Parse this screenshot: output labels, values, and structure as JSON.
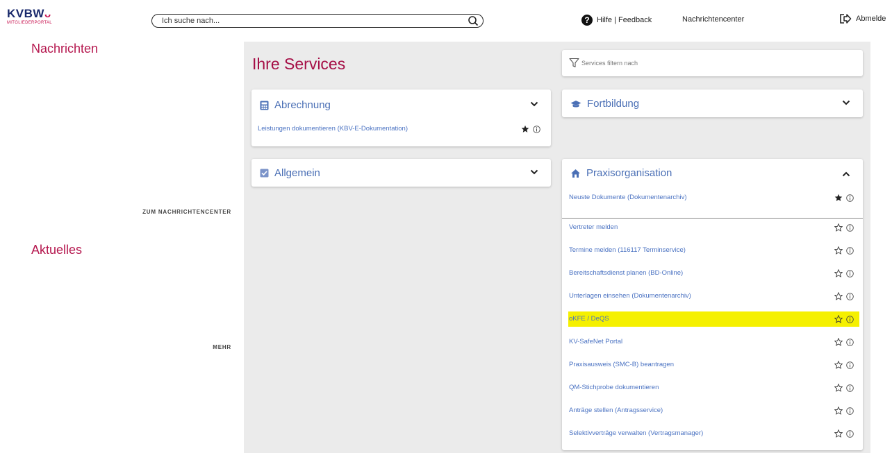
{
  "header": {
    "logo_text": "KVBW",
    "logo_sub": "MITGLIEDERPORTAL",
    "search_placeholder": "Ich suche nach...",
    "help_label": "Hilfe | Feedback",
    "nachrichtencenter_label": "Nachrichtencenter",
    "logout_label": "Abmelde"
  },
  "left": {
    "news_title": "Nachrichten",
    "news_link": "ZUM NACHRICHTENCENTER",
    "current_title": "Aktuelles",
    "current_link": "MEHR"
  },
  "main": {
    "title": "Ihre Services",
    "filter_placeholder": "Services filtern nach",
    "cards": {
      "abrechnung": {
        "title": "Abrechnung",
        "icon": "calculator-icon",
        "items": [
          {
            "label": "Leistungen dokumentieren (KBV-E-Dokumentation)",
            "favorite": true
          }
        ]
      },
      "allgemein": {
        "title": "Allgemein",
        "icon": "checkbox-icon"
      },
      "fortbildung": {
        "title": "Fortbildung",
        "icon": "graduation-cap-icon"
      },
      "praxisorganisation": {
        "title": "Praxisorganisation",
        "icon": "house-icon",
        "favorites": [
          {
            "label": "Neuste Dokumente (Dokumentenarchiv)",
            "favorite": true
          }
        ],
        "items": [
          {
            "label": "Vertreter melden",
            "favorite": false
          },
          {
            "label": "Termine melden (116117 Terminservice)",
            "favorite": false
          },
          {
            "label": "Bereitschaftsdienst planen (BD-Online)",
            "favorite": false
          },
          {
            "label": "Unterlagen einsehen (Dokumentenarchiv)",
            "favorite": false
          },
          {
            "label": "oKFE / DeQS",
            "favorite": false,
            "highlighted": true
          },
          {
            "label": "KV-SafeNet Portal",
            "favorite": false
          },
          {
            "label": "Praxisausweis (SMC-B) beantragen",
            "favorite": false
          },
          {
            "label": "QM-Stichprobe dokumentieren",
            "favorite": false
          },
          {
            "label": "Anträge stellen (Antragsservice)",
            "favorite": false
          },
          {
            "label": "Selektivverträge verwalten (Vertragsmanager)",
            "favorite": false
          }
        ]
      }
    }
  },
  "colors": {
    "brand": "#a50d45",
    "link": "#4a72c2",
    "highlight": "#f5f000",
    "panel_bg": "#ebebeb"
  }
}
